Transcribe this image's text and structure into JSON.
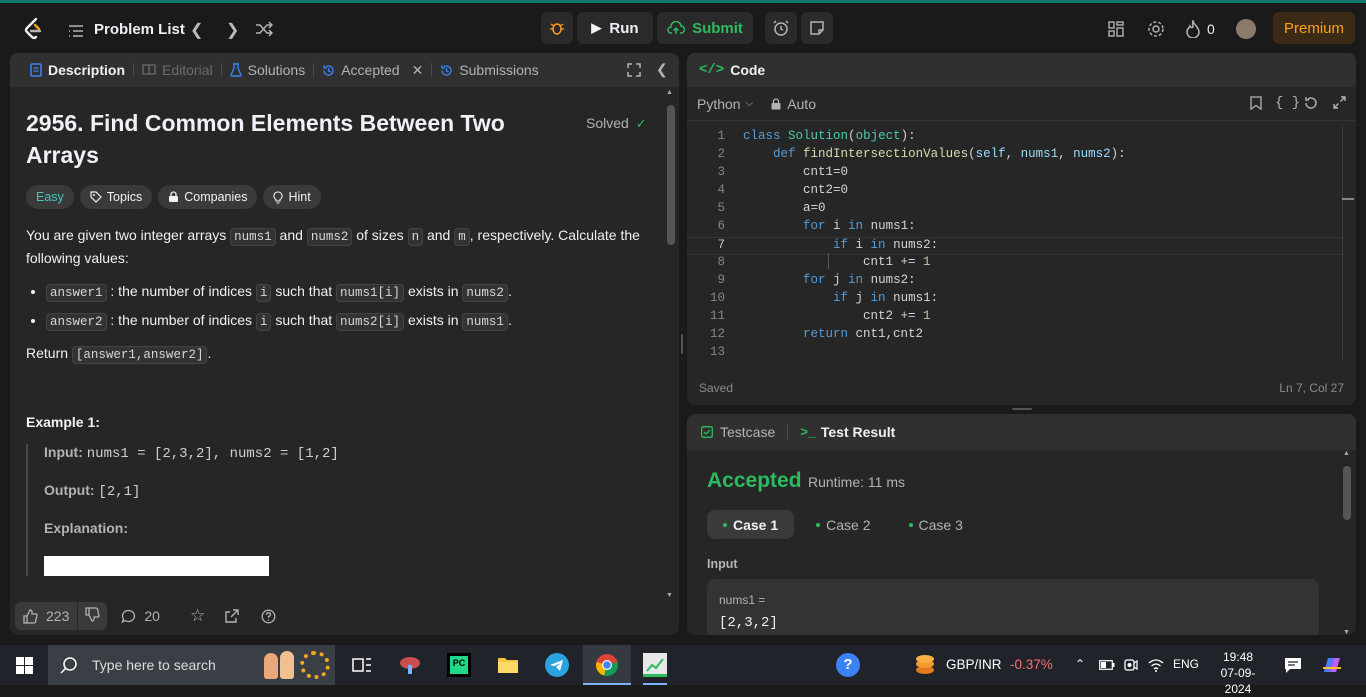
{
  "topnav": {
    "problem_list": "Problem List",
    "run": "Run",
    "submit": "Submit",
    "streak": "0",
    "premium": "Premium"
  },
  "left_tabs": {
    "description": "Description",
    "editorial": "Editorial",
    "solutions": "Solutions",
    "accepted": "Accepted",
    "submissions": "Submissions"
  },
  "problem": {
    "title": "2956. Find Common Elements Between Two Arrays",
    "solved": "Solved",
    "difficulty": "Easy",
    "topics": "Topics",
    "companies": "Companies",
    "hint": "Hint",
    "desc_p1_a": "You are given two integer arrays ",
    "nums1": "nums1",
    "desc_and": " and ",
    "nums2": "nums2",
    "desc_p1_b": " of sizes ",
    "n": "n",
    "desc_and2": " and ",
    "m": "m",
    "desc_p1_c": ", respectively. Calculate the following values:",
    "b1_code": "answer1",
    "b1_text_a": " : the number of indices ",
    "i": "i",
    "b1_text_b": " such that ",
    "b1_code2": "nums1[i]",
    "b1_text_c": " exists in ",
    "b1_code3": "nums2",
    "period": ".",
    "b2_code": "answer2",
    "b2_code2": "nums2[i]",
    "b2_code3": "nums1",
    "return_label": "Return ",
    "return_code": "[answer1,answer2]",
    "example_title": "Example 1:",
    "input_label": "Input:",
    "input_value": "nums1 = [2,3,2], nums2 = [1,2]",
    "output_label": "Output:",
    "output_value": "[2,1]",
    "explanation_label": "Explanation:"
  },
  "bottom_bar": {
    "likes": "223",
    "comments": "20"
  },
  "code": {
    "header": "Code",
    "language": "Python",
    "auto": "Auto",
    "lines": [
      "class Solution(object):",
      "    def findIntersectionValues(self, nums1, nums2):",
      "        cnt1=0",
      "        cnt2=0",
      "        a=0",
      "        for i in nums1:",
      "            if i in nums2:",
      "                cnt1 += 1",
      "        for j in nums2:",
      "            if j in nums1:",
      "                cnt2 += 1",
      "        return cnt1,cnt2",
      ""
    ],
    "line_numbers": [
      "1",
      "2",
      "3",
      "4",
      "5",
      "6",
      "7",
      "8",
      "9",
      "10",
      "11",
      "12",
      "13"
    ],
    "saved": "Saved",
    "cursor": "Ln 7, Col 27"
  },
  "testcase": {
    "tab_testcase": "Testcase",
    "tab_result": "Test Result",
    "status": "Accepted",
    "runtime": "Runtime: 11 ms",
    "cases": [
      "Case 1",
      "Case 2",
      "Case 3"
    ],
    "input_label": "Input",
    "param_name": "nums1 =",
    "param_value": "[2,3,2]"
  },
  "taskbar": {
    "search_placeholder": "Type here to search",
    "currency": "GBP/INR",
    "currency_change": "-0.37%",
    "lang": "ENG",
    "time": "19:48",
    "date": "07-09-2024"
  },
  "colors": {
    "accepted_green": "#2cbb5d",
    "easy_teal": "#46c6c2",
    "premium_orange": "#ffa116",
    "negative_red": "#f87171"
  }
}
